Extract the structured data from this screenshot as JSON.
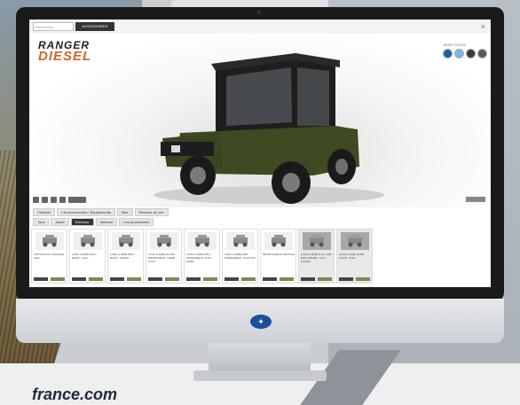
{
  "screen": {
    "search_placeholder": "Rechercher",
    "top_button": "ACCESSOIRES",
    "close_icon": "×"
  },
  "brand": {
    "line1": "RANGER",
    "line2": "DIESEL"
  },
  "swatches": {
    "label": "BODY STYLE",
    "colors": [
      "#1f5fa8",
      "#7fb4e0",
      "#3a3a3a",
      "#5a5a5a"
    ]
  },
  "vehicle": {
    "body_color": "#3d4a22",
    "tire_color": "#1a1a1a"
  },
  "nav_tabs": [
    "Véhicule",
    "Les Accessoires / Équipements",
    "Mes",
    "Résumé de vue"
  ],
  "sub_tabs": [
    "Tous",
    "Avant",
    "Extérieur",
    "Intérieur",
    "Les Accessoires"
  ],
  "active_sub_tab": 2,
  "products": [
    {
      "name": "TOIT EN POLY RANGER - FULL",
      "grey": false
    },
    {
      "name": "LOCK & RIDE POLY ROOF - FULL",
      "grey": false
    },
    {
      "name": "LOCK & RIDE POLY ROOF - SPORT",
      "grey": false
    },
    {
      "name": "LOCK & RIDE GLASS WINDSHIELD - HARD COAT",
      "grey": false
    },
    {
      "name": "LOCK & RIDE POLY WINDSHIELD - FULL FIXED",
      "grey": false
    },
    {
      "name": "LOCK & RIDE PRO WINDSHIELD - FLIP OUT",
      "grey": false
    },
    {
      "name": "RETROVISEUR CENTRAL",
      "grey": false
    },
    {
      "name": "LOCK & RIDE FULL CAB - ENCLOSURE - FULL DOORS",
      "grey": true
    },
    {
      "name": "LOCK & RIDE HARD DOOR - FULL",
      "grey": true
    }
  ],
  "footer_url": "france.com"
}
